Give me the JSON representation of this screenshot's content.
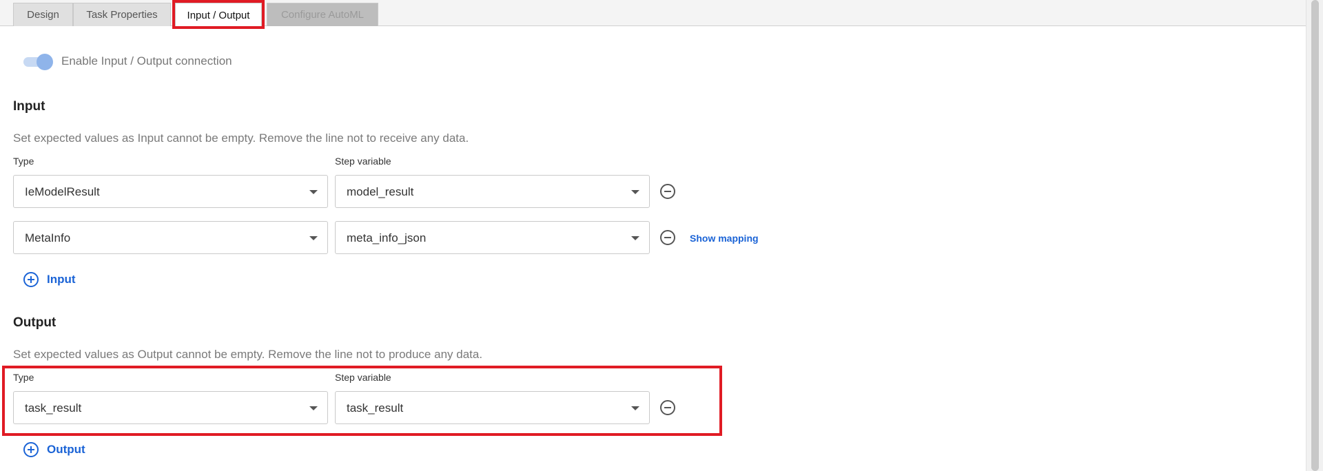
{
  "tabs": [
    {
      "label": "Design",
      "state": "normal"
    },
    {
      "label": "Task Properties",
      "state": "normal"
    },
    {
      "label": "Input / Output",
      "state": "active"
    },
    {
      "label": "Configure AutoML",
      "state": "disabled"
    }
  ],
  "toggle": {
    "label": "Enable Input / Output connection",
    "enabled": true
  },
  "input": {
    "heading": "Input",
    "description": "Set expected values as Input cannot be empty. Remove the line not to receive any data.",
    "type_label": "Type",
    "variable_label": "Step variable",
    "rows": [
      {
        "type": "IeModelResult",
        "variable": "model_result"
      },
      {
        "type": "MetaInfo",
        "variable": "meta_info_json",
        "link": "Show mapping"
      }
    ],
    "add_label": "Input"
  },
  "output": {
    "heading": "Output",
    "description": "Set expected values as Output cannot be empty. Remove the line not to produce any data.",
    "type_label": "Type",
    "variable_label": "Step variable",
    "rows": [
      {
        "type": "task_result",
        "variable": "task_result"
      }
    ],
    "add_label": "Output"
  },
  "colors": {
    "accent": "#1a63d6",
    "highlight": "#e01b24"
  }
}
